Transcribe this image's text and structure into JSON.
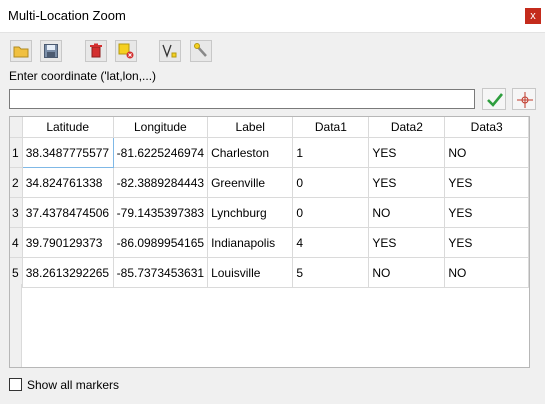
{
  "window": {
    "title": "Multi-Location Zoom",
    "close_glyph": "x"
  },
  "toolbar": [
    {
      "name": "open-folder-icon",
      "tooltip": ""
    },
    {
      "name": "save-icon",
      "tooltip": ""
    },
    {
      "name": "delete-icon",
      "tooltip": ""
    },
    {
      "name": "clear-markers-icon",
      "tooltip": ""
    },
    {
      "name": "vertex-line-icon",
      "tooltip": ""
    },
    {
      "name": "settings-wrench-icon",
      "tooltip": ""
    }
  ],
  "coord": {
    "label": "Enter coordinate ('lat,lon,...)",
    "value": "",
    "placeholder": ""
  },
  "table": {
    "headers": [
      "Latitude",
      "Longitude",
      "Label",
      "Data1",
      "Data2",
      "Data3"
    ],
    "rows": [
      {
        "num": "1",
        "cells": [
          "38.3487775577",
          "-81.6225246974",
          "Charleston",
          "1",
          "YES",
          "NO"
        ]
      },
      {
        "num": "2",
        "cells": [
          "34.824761338",
          "-82.3889284443",
          "Greenville",
          "0",
          "YES",
          "YES"
        ]
      },
      {
        "num": "3",
        "cells": [
          "37.4378474506",
          "-79.1435397383",
          "Lynchburg",
          "0",
          "NO",
          "YES"
        ]
      },
      {
        "num": "4",
        "cells": [
          "39.790129373",
          "-86.0989954165",
          "Indianapolis",
          "4",
          "YES",
          "YES"
        ]
      },
      {
        "num": "5",
        "cells": [
          "38.2613292265",
          "-85.7373453631",
          "Louisville",
          "5",
          "NO",
          "NO"
        ]
      }
    ]
  },
  "footer": {
    "show_all_markers_label": "Show all markers",
    "show_all_markers_checked": false
  },
  "colors": {
    "accept_green": "#2e9e3e",
    "close_red": "#c42b1c",
    "delete_red": "#d32f2f",
    "folder_yellow": "#f0c040"
  }
}
